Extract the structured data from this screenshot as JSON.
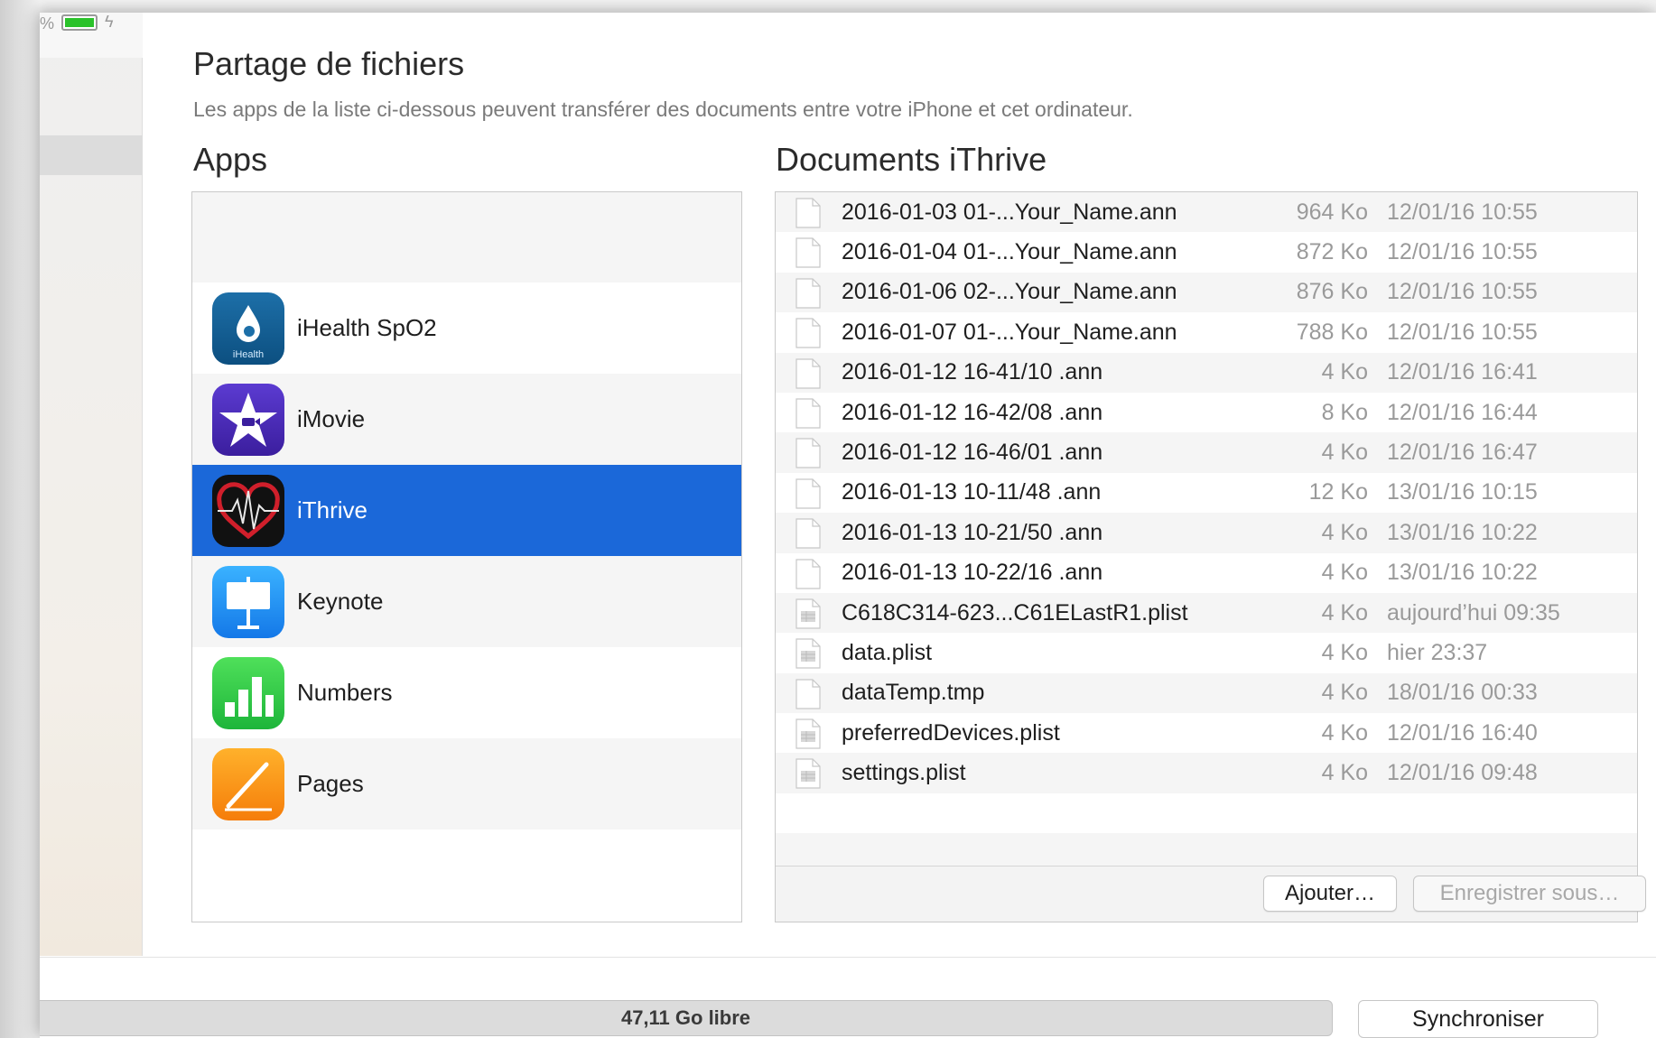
{
  "status": {
    "battery_percent_glyph": "%",
    "battery_level": 1.0
  },
  "header": {
    "title": "Partage de fichiers",
    "subtitle": "Les apps de la liste ci-dessous peuvent transférer des documents entre votre iPhone et cet ordinateur."
  },
  "apps": {
    "heading": "Apps",
    "items": [
      {
        "label": "iHealth SpO2",
        "icon": "ihealth-icon",
        "icon_text": "iHealth"
      },
      {
        "label": "iMovie",
        "icon": "imovie-icon"
      },
      {
        "label": "iThrive",
        "icon": "ithrive-icon",
        "selected": true
      },
      {
        "label": "Keynote",
        "icon": "keynote-icon"
      },
      {
        "label": "Numbers",
        "icon": "numbers-icon"
      },
      {
        "label": "Pages",
        "icon": "pages-icon"
      }
    ]
  },
  "documents": {
    "heading": "Documents iThrive",
    "rows": [
      {
        "name": "2016-01-03 01-...Your_Name.ann",
        "size": "964 Ko",
        "date": "12/01/16 10:55",
        "icon": "file-icon"
      },
      {
        "name": "2016-01-04 01-...Your_Name.ann",
        "size": "872 Ko",
        "date": "12/01/16 10:55",
        "icon": "file-icon"
      },
      {
        "name": "2016-01-06 02-...Your_Name.ann",
        "size": "876 Ko",
        "date": "12/01/16 10:55",
        "icon": "file-icon"
      },
      {
        "name": "2016-01-07 01-...Your_Name.ann",
        "size": "788 Ko",
        "date": "12/01/16 10:55",
        "icon": "file-icon"
      },
      {
        "name": "2016-01-12 16-41/10 .ann",
        "size": "4 Ko",
        "date": "12/01/16 16:41",
        "icon": "file-icon"
      },
      {
        "name": "2016-01-12 16-42/08 .ann",
        "size": "8 Ko",
        "date": "12/01/16 16:44",
        "icon": "file-icon"
      },
      {
        "name": "2016-01-12 16-46/01 .ann",
        "size": "4 Ko",
        "date": "12/01/16 16:47",
        "icon": "file-icon"
      },
      {
        "name": "2016-01-13 10-11/48 .ann",
        "size": "12 Ko",
        "date": "13/01/16 10:15",
        "icon": "file-icon"
      },
      {
        "name": "2016-01-13 10-21/50 .ann",
        "size": "4 Ko",
        "date": "13/01/16 10:22",
        "icon": "file-icon"
      },
      {
        "name": "2016-01-13 10-22/16 .ann",
        "size": "4 Ko",
        "date": "13/01/16 10:22",
        "icon": "file-icon"
      },
      {
        "name": "C618C314-623...C61ELastR1.plist",
        "size": "4 Ko",
        "date": "aujourd’hui 09:35",
        "icon": "plist-icon"
      },
      {
        "name": "data.plist",
        "size": "4 Ko",
        "date": "hier 23:37",
        "icon": "plist-icon"
      },
      {
        "name": "dataTemp.tmp",
        "size": "4 Ko",
        "date": "18/01/16 00:33",
        "icon": "file-icon"
      },
      {
        "name": "preferredDevices.plist",
        "size": "4 Ko",
        "date": "12/01/16 16:40",
        "icon": "plist-icon"
      },
      {
        "name": "settings.plist",
        "size": "4 Ko",
        "date": "12/01/16 09:48",
        "icon": "plist-icon"
      }
    ],
    "add_button": "Ajouter…",
    "save_button": "Enregistrer sous…"
  },
  "footer": {
    "storage_label": "47,11 Go libre",
    "sync_button": "Synchroniser"
  },
  "colors": {
    "selection": "#1b68d9",
    "battery": "#2ac22a"
  }
}
